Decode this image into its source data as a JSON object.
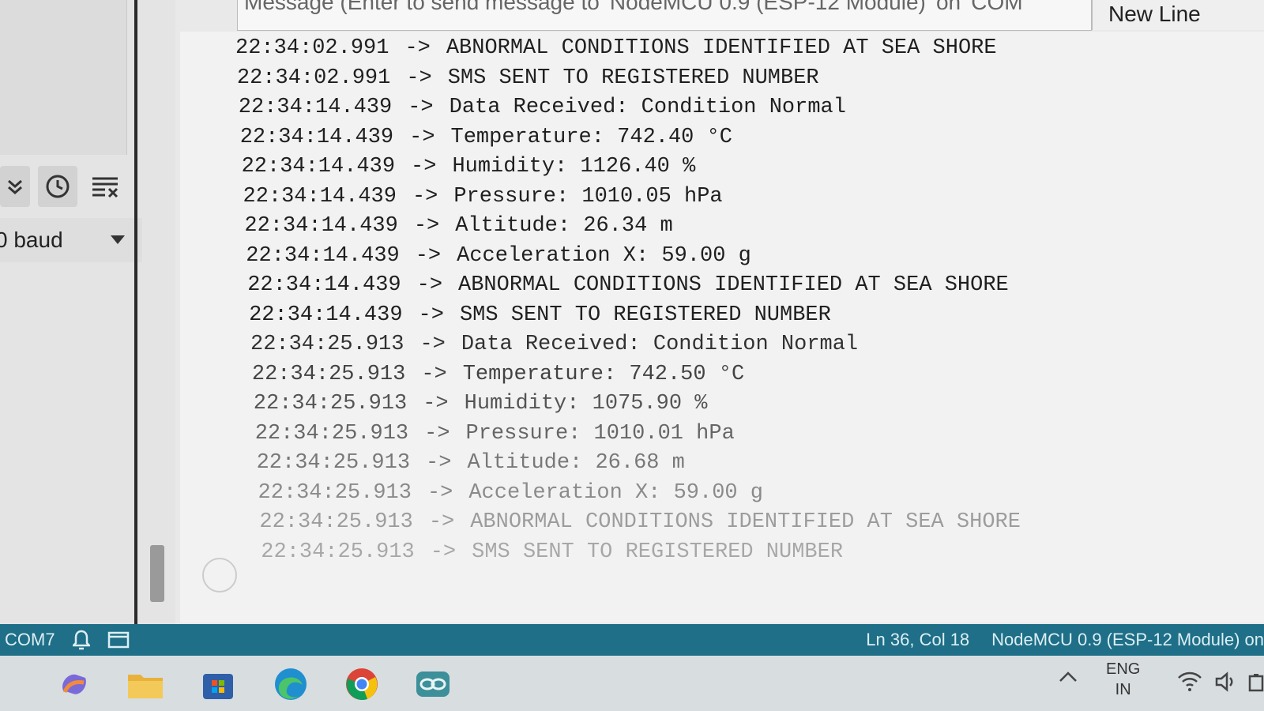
{
  "message_bar": {
    "placeholder": "Message (Enter to send message to 'NodeMCU 0.9 (ESP-12 Module)' on 'COM",
    "line_ending": "New Line"
  },
  "toolbar": {
    "baud_rate": "0 baud",
    "icons": [
      "collapse-icon",
      "timestamp-icon",
      "clear-output-icon"
    ]
  },
  "serial_lines": [
    {
      "ts": "22:34:02.991",
      "arrow": "->",
      "msg": "ABNORMAL CONDITIONS IDENTIFIED AT SEA SHORE"
    },
    {
      "ts": "22:34:02.991",
      "arrow": "->",
      "msg": "SMS SENT TO REGISTERED NUMBER"
    },
    {
      "ts": "22:34:14.439",
      "arrow": "->",
      "msg": "Data Received: Condition Normal"
    },
    {
      "ts": "22:34:14.439",
      "arrow": "->",
      "msg": "Temperature: 742.40 °C"
    },
    {
      "ts": "22:34:14.439",
      "arrow": "->",
      "msg": "Humidity: 1126.40 %"
    },
    {
      "ts": "22:34:14.439",
      "arrow": "->",
      "msg": "Pressure: 1010.05 hPa"
    },
    {
      "ts": "22:34:14.439",
      "arrow": "->",
      "msg": "Altitude: 26.34 m"
    },
    {
      "ts": "22:34:14.439",
      "arrow": "->",
      "msg": "Acceleration X: 59.00 g"
    },
    {
      "ts": "22:34:14.439",
      "arrow": "->",
      "msg": "ABNORMAL CONDITIONS IDENTIFIED AT SEA SHORE"
    },
    {
      "ts": "22:34:14.439",
      "arrow": "->",
      "msg": "SMS SENT TO REGISTERED NUMBER"
    },
    {
      "ts": "22:34:25.913",
      "arrow": "->",
      "msg": "Data Received: Condition Normal"
    },
    {
      "ts": "22:34:25.913",
      "arrow": "->",
      "msg": "Temperature: 742.50 °C"
    },
    {
      "ts": "22:34:25.913",
      "arrow": "->",
      "msg": "Humidity: 1075.90 %"
    },
    {
      "ts": "22:34:25.913",
      "arrow": "->",
      "msg": "Pressure: 1010.01 hPa"
    },
    {
      "ts": "22:34:25.913",
      "arrow": "->",
      "msg": "Altitude: 26.68 m"
    },
    {
      "ts": "22:34:25.913",
      "arrow": "->",
      "msg": "Acceleration X: 59.00 g"
    },
    {
      "ts": "22:34:25.913",
      "arrow": "->",
      "msg": "ABNORMAL CONDITIONS IDENTIFIED AT SEA SHORE"
    },
    {
      "ts": "22:34:25.913",
      "arrow": "->",
      "msg": "SMS SENT TO REGISTERED NUMBER"
    }
  ],
  "status_bar": {
    "port": "COM7",
    "cursor": "Ln 36, Col 18",
    "board": "NodeMCU 0.9 (ESP-12 Module) on"
  },
  "taskbar": {
    "apps": [
      "copilot-icon",
      "file-explorer-icon",
      "microsoft-store-icon",
      "edge-icon",
      "chrome-icon",
      "arduino-icon"
    ],
    "language_line1": "ENG",
    "language_line2": "IN"
  },
  "colors": {
    "status_bar": "#1e6f87",
    "output_bg": "#f2f2f2",
    "taskbar_bg": "#d8dde0"
  }
}
